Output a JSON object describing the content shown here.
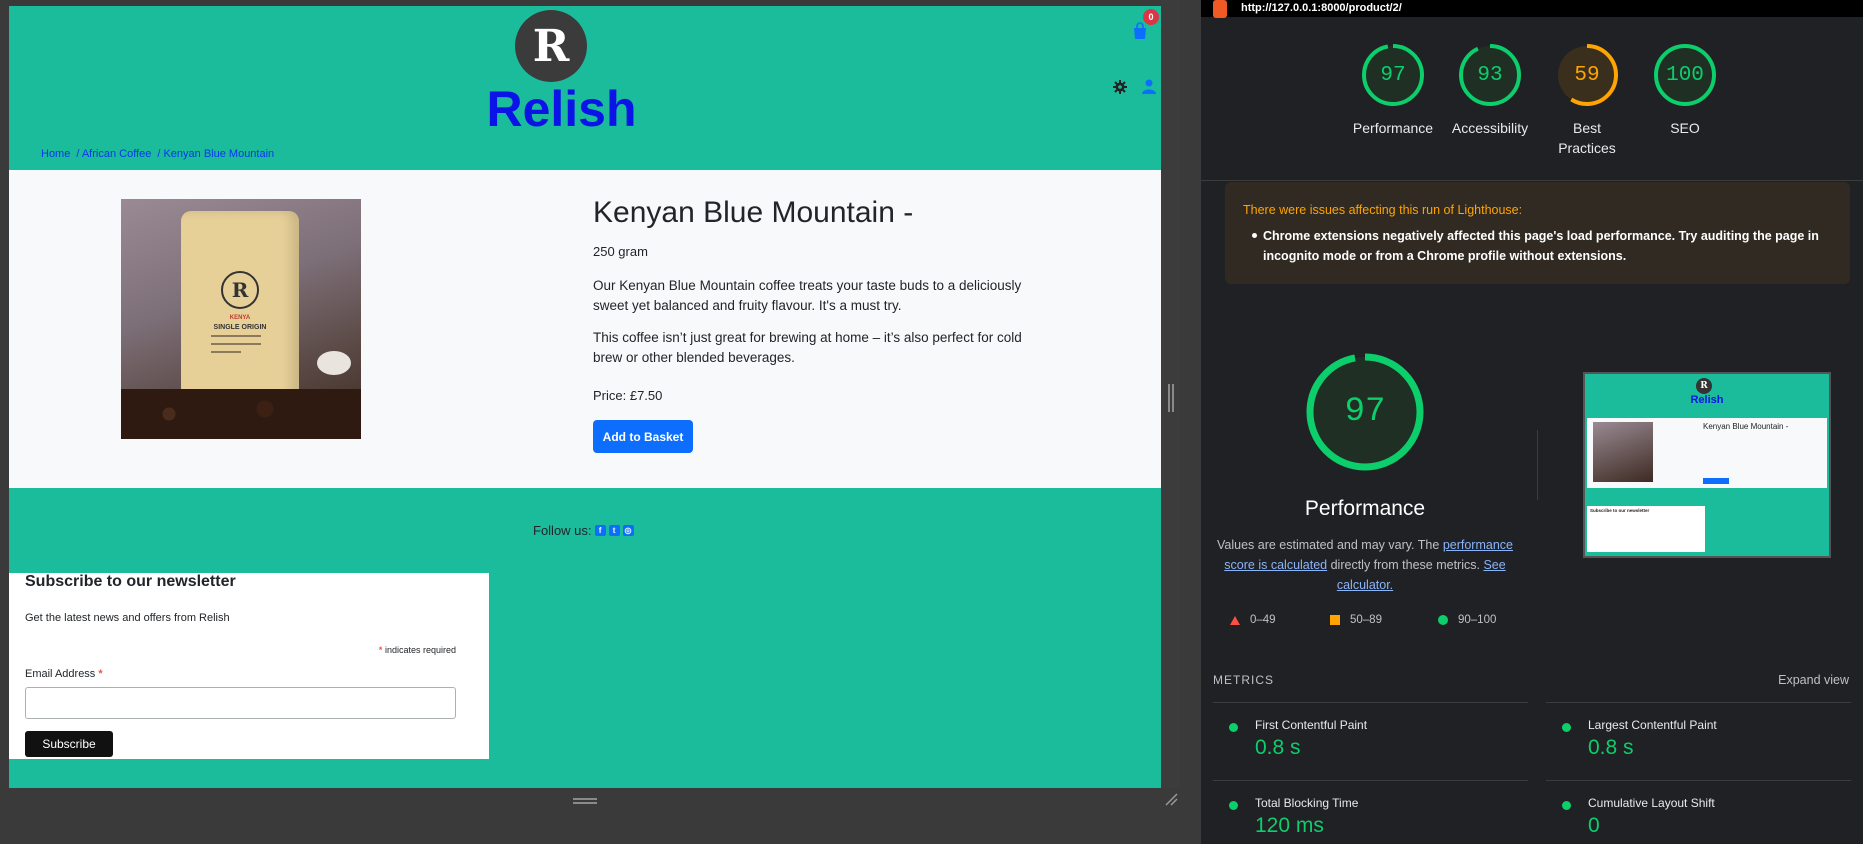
{
  "site": {
    "logo_letter": "R",
    "title": "Relish",
    "basket_count": "0",
    "breadcrumb": [
      "Home",
      "/ African Coffee",
      "/ Kenyan Blue Mountain"
    ]
  },
  "product": {
    "name": "Kenyan Blue Mountain -",
    "weight": "250 gram",
    "desc1": "Our Kenyan Blue Mountain coffee treats your taste buds to a deliciously sweet yet balanced and fruity flavour. It's a must try.",
    "desc2": "This coffee isn’t just great for brewing at home – it’s also perfect for cold brew or other blended beverages.",
    "price": "Price: £7.50",
    "add_button": "Add to Basket",
    "image_bag_logo": "R",
    "image_bag_line1": "KENYA",
    "image_bag_line2": "SINGLE ORIGIN"
  },
  "footer": {
    "follow": "Follow us:",
    "social_icons": [
      "facebook-icon",
      "twitter-icon",
      "instagram-icon"
    ]
  },
  "newsletter": {
    "title": "Subscribe to our newsletter",
    "subtitle": "Get the latest news and offers from Relish",
    "required_note": "indicates required",
    "required_mark": "*",
    "email_label": "Email Address",
    "email_value": "",
    "subscribe": "Subscribe"
  },
  "lighthouse": {
    "url": "http://127.0.0.1:8000/product/2/",
    "scores": [
      {
        "label": "Performance",
        "value": 97,
        "color": "#0cce6b"
      },
      {
        "label": "Accessibility",
        "value": 93,
        "color": "#0cce6b"
      },
      {
        "label": "Best Practices",
        "value": 59,
        "color": "#ffa400"
      },
      {
        "label": "SEO",
        "value": 100,
        "color": "#0cce6b"
      }
    ],
    "warning_title": "There were issues affecting this run of Lighthouse:",
    "warning_item": "Chrome extensions negatively affected this page's load performance. Try auditing the page in incognito mode or from a Chrome profile without extensions.",
    "big_score": 97,
    "big_label": "Performance",
    "desc_pre": "Values are estimated and may vary. The",
    "desc_link1": "performance score is calculated",
    "desc_mid": "directly from these metrics.",
    "desc_link2": "See calculator.",
    "legend": [
      "0–49",
      "50–89",
      "90–100"
    ],
    "metrics_heading": "METRICS",
    "expand_view": "Expand view",
    "metrics": [
      {
        "name": "First Contentful Paint",
        "value": "0.8 s"
      },
      {
        "name": "Largest Contentful Paint",
        "value": "0.8 s"
      },
      {
        "name": "Total Blocking Time",
        "value": "120 ms"
      },
      {
        "name": "Cumulative Layout Shift",
        "value": "0"
      }
    ],
    "thumb_title": "Relish",
    "thumb_name": "Kenyan Blue Mountain -",
    "thumb_nl": "Subscribe to our newsletter"
  }
}
